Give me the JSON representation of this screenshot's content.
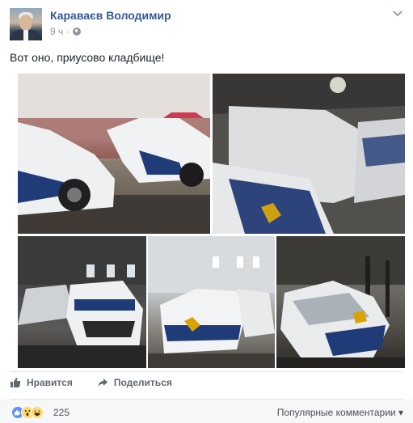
{
  "header": {
    "author": "Караваєв Володимир",
    "time": "9 ч",
    "separator": "·",
    "privacy_icon": "globe-icon",
    "menu_icon": "chevron-down-icon"
  },
  "post": {
    "text": "Вот оно, приусово кладбище!",
    "photo_count": 5
  },
  "actions": {
    "like_label": "Нравится",
    "like_icon": "thumbs-up-icon",
    "share_label": "Поделиться",
    "share_icon": "share-arrow-icon"
  },
  "reactions": {
    "icons": [
      "like-reaction-icon",
      "wow-reaction-icon",
      "haha-reaction-icon"
    ],
    "count": "225",
    "sort_label": "Популярные комментарии ▾"
  },
  "colors": {
    "author_link": "#365899",
    "secondary_text": "#90949c",
    "action_text": "#616770",
    "footer_bg": "#f6f7f9",
    "like_blue": "#5890ff",
    "emoji_yellow": "#ffd972"
  }
}
